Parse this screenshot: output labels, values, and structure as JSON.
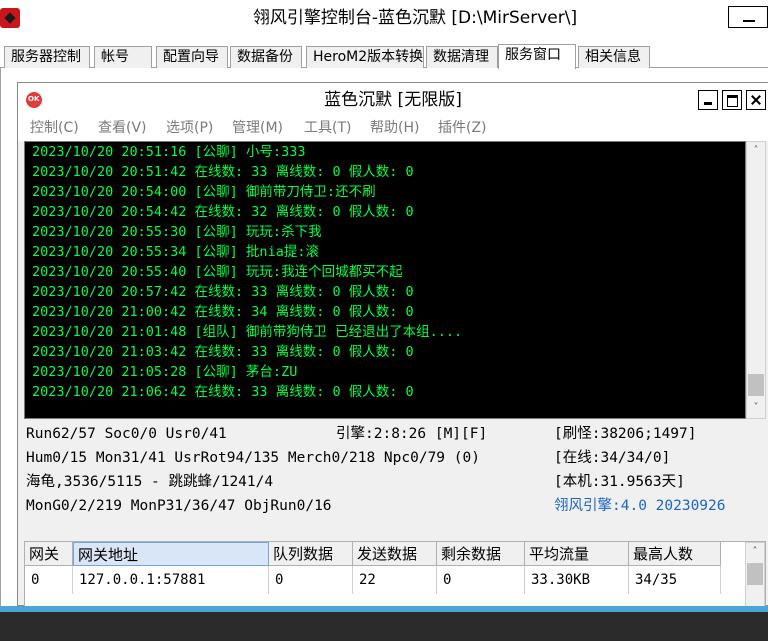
{
  "outer": {
    "title": "翎风引擎控制台-蓝色沉默 [D:\\MirServer\\]",
    "tabs": [
      "服务器控制",
      "帐号",
      "配置向导",
      "数据备份",
      "HeroM2版本转换",
      "数据清理",
      "服务窗口",
      "相关信息"
    ],
    "active_tab": "服务窗口"
  },
  "inner": {
    "title": "蓝色沉默 [无限版]",
    "menu": [
      "控制(C)",
      "查看(V)",
      "选项(P)",
      "管理(M)",
      "工具(T)",
      "帮助(H)",
      "插件(Z)"
    ]
  },
  "log": [
    "2023/10/20 20:51:16 [公聊] 小号:333",
    "2023/10/20 20:51:42 在线数: 33 离线数: 0 假人数: 0",
    "2023/10/20 20:54:00 [公聊] 御前带刀侍卫:还不刷",
    "2023/10/20 20:54:42 在线数: 32 离线数: 0 假人数: 0",
    "2023/10/20 20:55:30 [公聊] 玩玩:杀下我",
    "2023/10/20 20:55:34 [公聊] 批nia提:滚",
    "2023/10/20 20:55:40 [公聊] 玩玩:我连个回城都买不起",
    "2023/10/20 20:57:42 在线数: 33 离线数: 0 假人数: 0",
    "2023/10/20 21:00:42 在线数: 34 离线数: 0 假人数: 0",
    "2023/10/20 21:01:48 [组队] 御前带狗侍卫 已经退出了本组....",
    "2023/10/20 21:03:42 在线数: 33 离线数: 0 假人数: 0",
    "2023/10/20 21:05:28 [公聊] 茅台:ZU",
    "2023/10/20 21:06:42 在线数: 33 离线数: 0 假人数: 0"
  ],
  "stats": {
    "run": "Run62/57 Soc0/0 Usr0/41",
    "engine_time": "引擎:2:8:26 [M][F]",
    "refresh": "[刷怪:38206;1497]",
    "hum": "Hum0/15 Mon31/41 UsrRot94/135 Merch0/218 Npc0/79 (0)",
    "online": "[在线:34/34/0]",
    "map": "海龟,3536/5115 - 跳跳蜂/1241/4",
    "local": "[本机:31.9563天]",
    "mong": "MonG0/2/219 MonP31/36/47 ObjRun0/16",
    "version": "翎风引擎:4.0 20230926"
  },
  "grid": {
    "headers": [
      "网关",
      "网关地址",
      "队列数据",
      "发送数据",
      "剩余数据",
      "平均流量",
      "最高人数"
    ],
    "row": [
      "0",
      "127.0.0.1:57881",
      "0",
      "22",
      "0",
      "33.30KB",
      "34/35"
    ]
  },
  "colors": {
    "log_text": "#00ff41",
    "log_bg": "#000000",
    "version_text": "#1a66c8"
  }
}
